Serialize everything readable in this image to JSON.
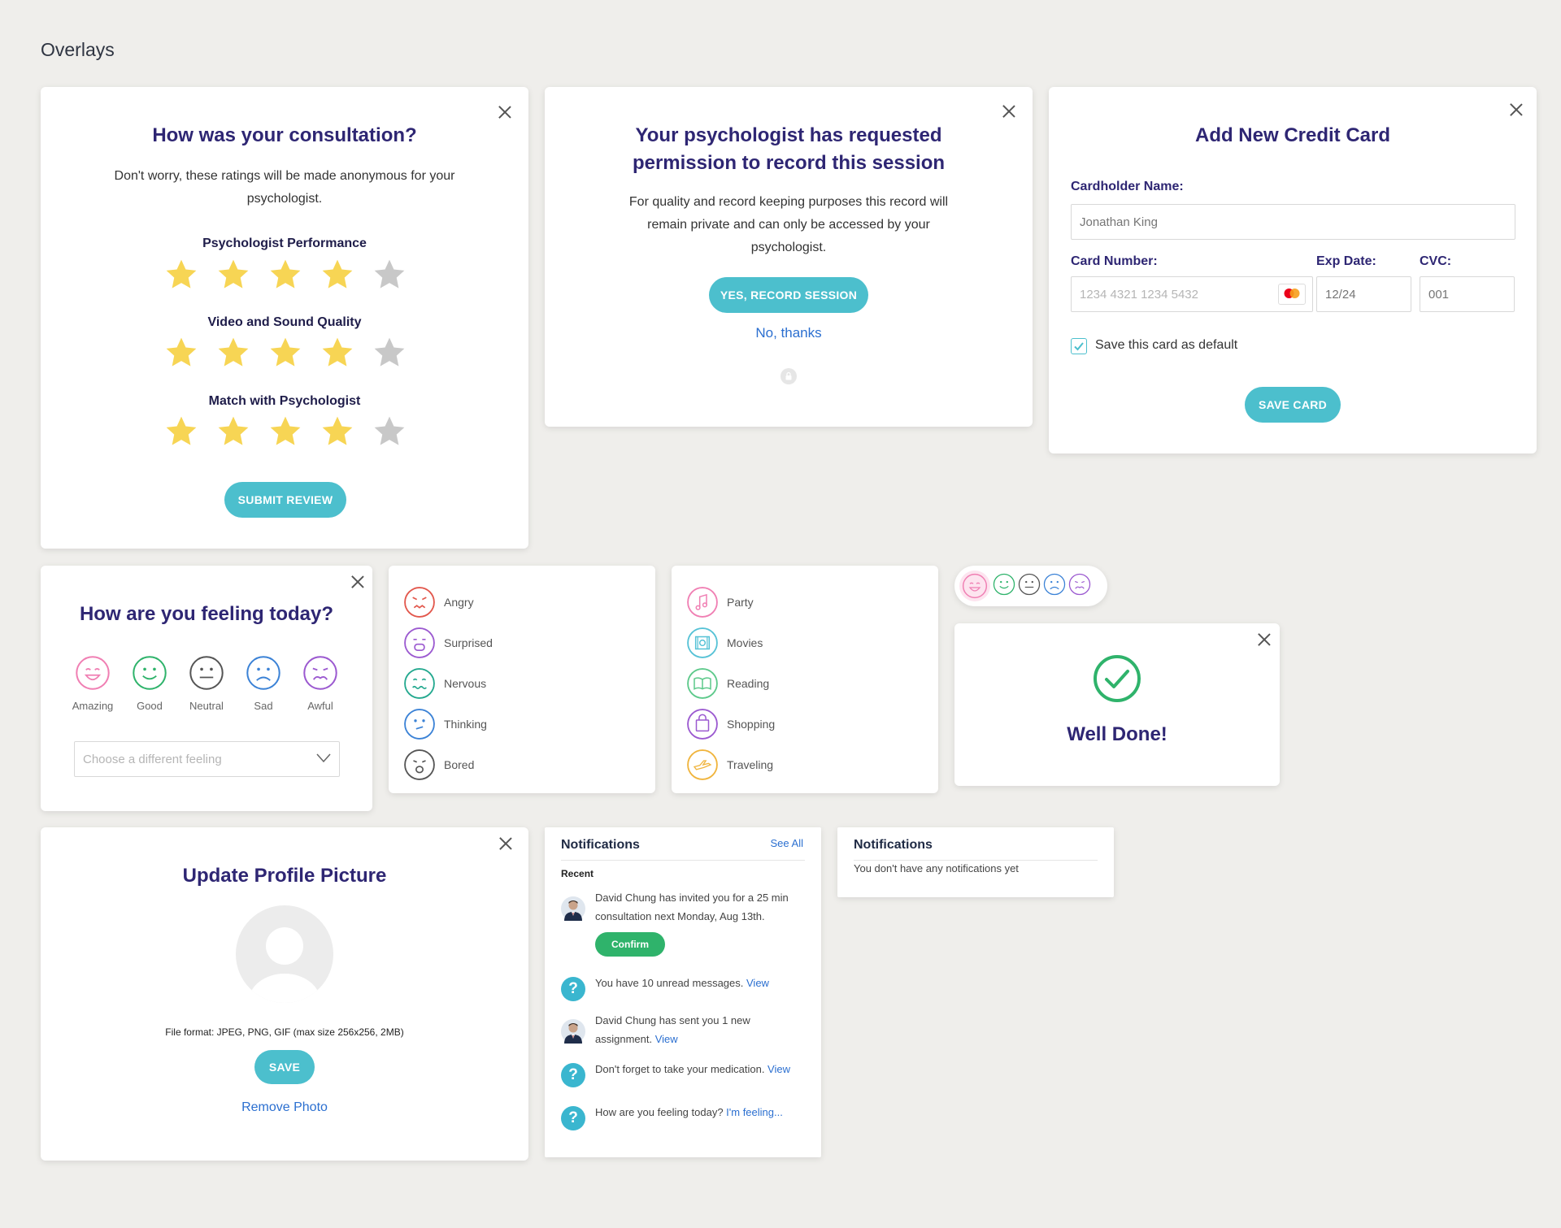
{
  "page": {
    "title": "Overlays"
  },
  "consultation": {
    "title": "How was your consultation?",
    "description": "Don't worry, these ratings will be made anonymous for your psychologist.",
    "ratings": [
      {
        "label": "Psychologist Performance",
        "value": 4,
        "max": 5
      },
      {
        "label": "Video and Sound Quality",
        "value": 4,
        "max": 5
      },
      {
        "label": "Match with Psychologist",
        "value": 4,
        "max": 5
      }
    ],
    "submit_label": "SUBMIT REVIEW"
  },
  "record": {
    "title_line1": "Your psychologist has requested",
    "title_line2": "permission to record this session",
    "description": "For quality and record keeping purposes this record will remain private and can only be accessed by your psychologist.",
    "confirm_label": "YES, RECORD SESSION",
    "decline_label": "No, thanks"
  },
  "credit_card": {
    "title": "Add New Credit Card",
    "cardholder_label": "Cardholder Name:",
    "cardholder_placeholder": "Jonathan King",
    "card_number_label": "Card Number:",
    "card_number_placeholder": "1234 4321 1234 5432",
    "exp_label": "Exp Date:",
    "exp_placeholder": "12/24",
    "cvc_label": "CVC:",
    "cvc_placeholder": "001",
    "save_default_label": "Save this card as default",
    "save_default_checked": true,
    "save_label": "SAVE CARD"
  },
  "feeling": {
    "title": "How are you feeling today?",
    "faces": [
      {
        "label": "Amazing",
        "icon": "grin-face-icon",
        "color": "#f07fb3"
      },
      {
        "label": "Good",
        "icon": "smile-face-icon",
        "color": "#2fb36b"
      },
      {
        "label": "Neutral",
        "icon": "neutral-face-icon",
        "color": "#555555"
      },
      {
        "label": "Sad",
        "icon": "sad-face-icon",
        "color": "#3b82d6"
      },
      {
        "label": "Awful",
        "icon": "awful-face-icon",
        "color": "#9b59d0"
      }
    ],
    "select_placeholder": "Choose a different feeling"
  },
  "emotions": [
    {
      "label": "Angry",
      "color": "#e2574c"
    },
    {
      "label": "Surprised",
      "color": "#9b59d0"
    },
    {
      "label": "Nervous",
      "color": "#22a88e"
    },
    {
      "label": "Thinking",
      "color": "#3b82d6"
    },
    {
      "label": "Bored",
      "color": "#555555"
    }
  ],
  "activities": [
    {
      "label": "Party",
      "color": "#f07fb3"
    },
    {
      "label": "Movies",
      "color": "#56c2d6"
    },
    {
      "label": "Reading",
      "color": "#5cc98a"
    },
    {
      "label": "Shopping",
      "color": "#9b59d0"
    },
    {
      "label": "Traveling",
      "color": "#f0b43c"
    }
  ],
  "well_done": {
    "title": "Well Done!"
  },
  "profile": {
    "title": "Update Profile Picture",
    "format_text": "File format: JPEG, PNG, GIF (max size 256x256, 2MB)",
    "save_label": "SAVE",
    "remove_label": "Remove Photo"
  },
  "notifications": {
    "title": "Notifications",
    "see_all": "See All",
    "section": "Recent",
    "items": [
      {
        "text": "David Chung has invited you for a 25 min consultation next Monday, Aug 13th.",
        "link": "",
        "action": "Confirm",
        "type": "avatar"
      },
      {
        "text": "You have 10 unread messages. ",
        "link": "View",
        "type": "question"
      },
      {
        "text": "David Chung has sent you 1 new assignment. ",
        "link": "View",
        "type": "avatar"
      },
      {
        "text": "Don't forget to take your medication. ",
        "link": "View",
        "type": "question"
      },
      {
        "text": "How are you feeling today? ",
        "link": "I'm feeling...",
        "type": "question"
      }
    ]
  },
  "notifications_empty": {
    "title": "Notifications",
    "message": "You don't have any notifications yet"
  },
  "colors": {
    "accent": "#4cbfcd",
    "title": "#2e2673",
    "link": "#2b6fd0",
    "star_on": "#f7d554",
    "star_off": "#c8c8c8",
    "success": "#2fb36b"
  }
}
